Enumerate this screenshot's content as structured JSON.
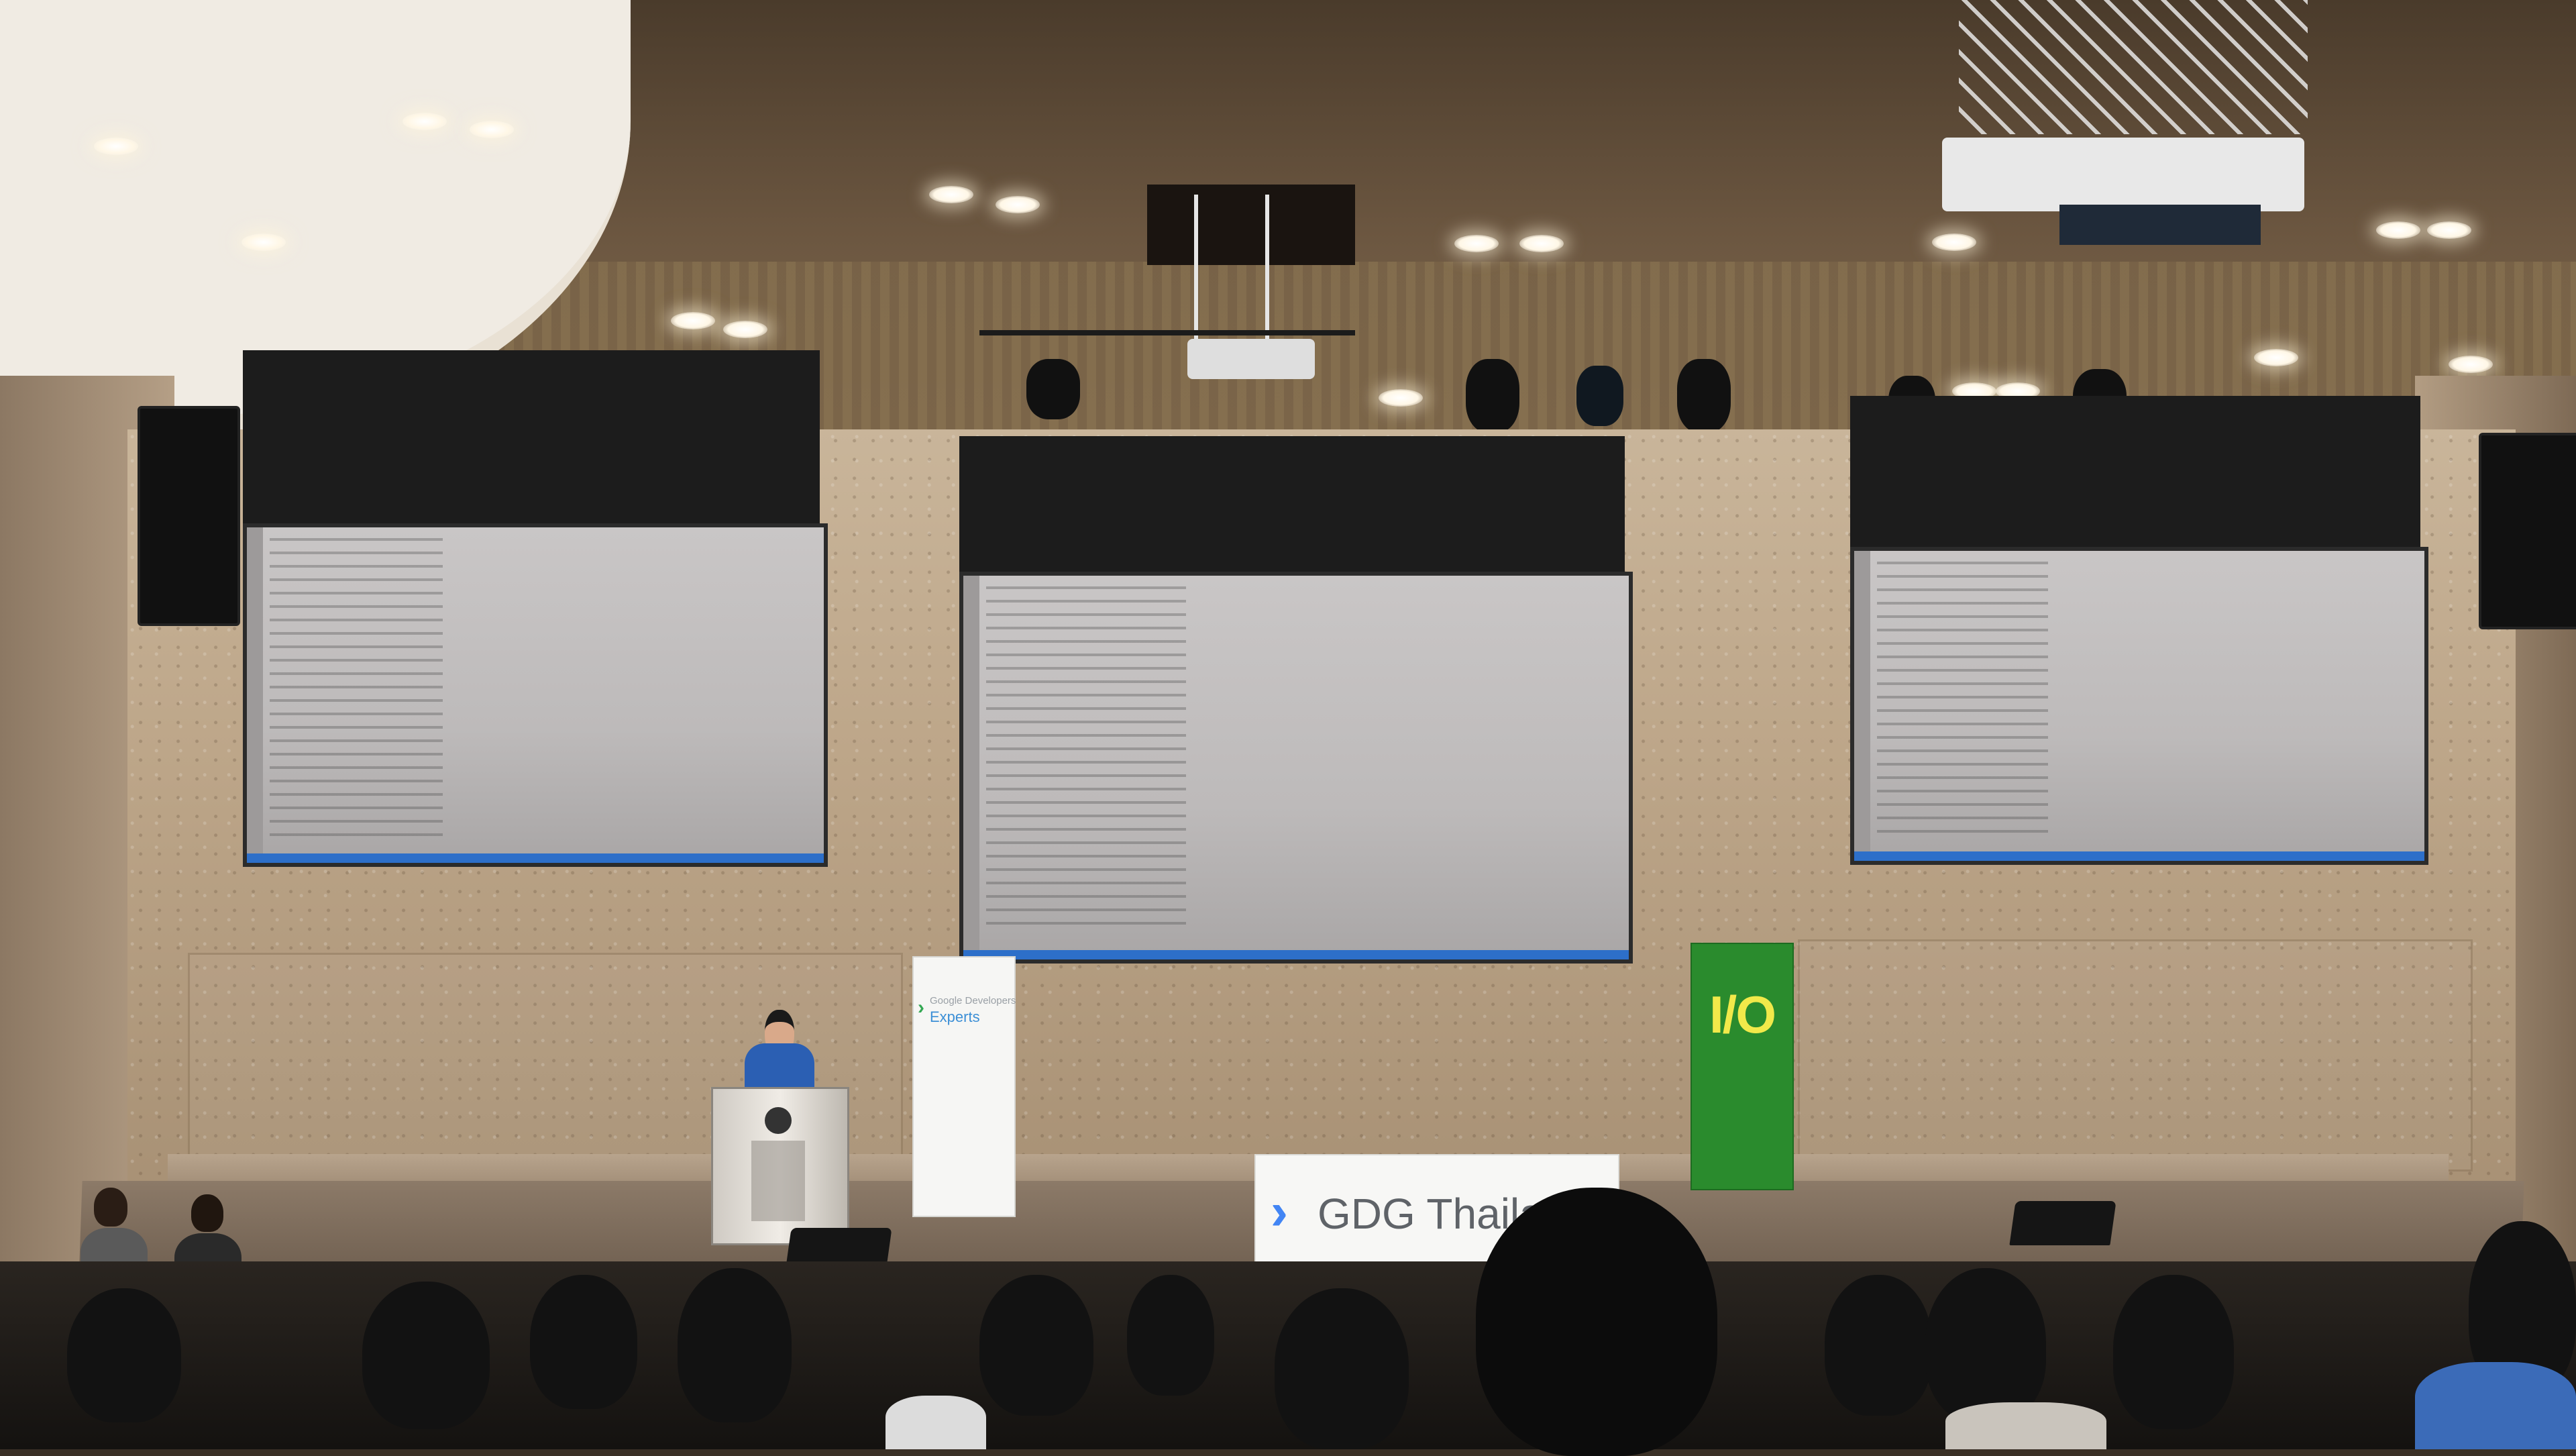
{
  "scene": {
    "type": "conference-auditorium"
  },
  "banners": {
    "gde": {
      "line1": "Google Developers",
      "line2": "Experts"
    },
    "io": {
      "label": "I/O"
    },
    "gdg": {
      "label": "GDG Thaila"
    }
  },
  "colors": {
    "google_blue": "#4285f4",
    "io_green": "#2a8b2d",
    "io_yellow": "#f1e94a",
    "editor_statusbar": "#2d6fc9"
  }
}
